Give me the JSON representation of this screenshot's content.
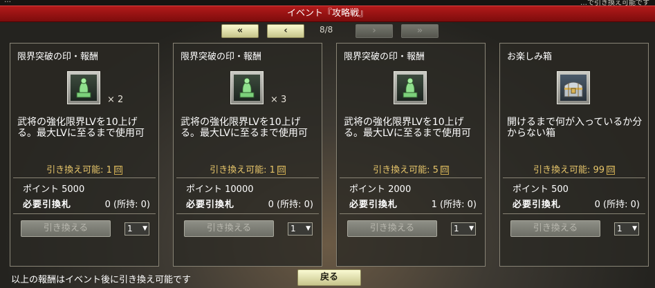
{
  "header": {
    "top_left": "…",
    "top_right": "…で引き換え可能です",
    "title": "イベント『攻略戦』"
  },
  "pager": {
    "first_label": "«",
    "prev_label": "‹",
    "indicator": "8/8",
    "next_label": "›",
    "last_label": "»"
  },
  "cards": [
    {
      "title": "限界突破の印・報酬",
      "icon": "jade-seal-icon",
      "quantity": "× 2",
      "description": "武将の強化限界LVを10上げる。最大LVに至るまで使用可",
      "exchangeable_label": "引き換え可能: 1",
      "exchangeable_unit": "回",
      "points": "ポイント 5000",
      "ticket_label": "必要引換札",
      "ticket_value": "0 (所持: 0)",
      "button": "引き換える",
      "select_value": "1"
    },
    {
      "title": "限界突破の印・報酬",
      "icon": "jade-seal-icon",
      "quantity": "× 3",
      "description": "武将の強化限界LVを10上げる。最大LVに至るまで使用可",
      "exchangeable_label": "引き換え可能: 1",
      "exchangeable_unit": "回",
      "points": "ポイント 10000",
      "ticket_label": "必要引換札",
      "ticket_value": "0 (所持: 0)",
      "button": "引き換える",
      "select_value": "1"
    },
    {
      "title": "限界突破の印・報酬",
      "icon": "jade-seal-icon",
      "quantity": "",
      "description": "武将の強化限界LVを10上げる。最大LVに至るまで使用可",
      "exchangeable_label": "引き換え可能: 5",
      "exchangeable_unit": "回",
      "points": "ポイント 2000",
      "ticket_label": "必要引換札",
      "ticket_value": "1 (所持: 0)",
      "button": "引き換える",
      "select_value": "1"
    },
    {
      "title": "お楽しみ箱",
      "icon": "treasure-chest-icon",
      "quantity": "",
      "description": "開けるまで何が入っているか分からない箱",
      "exchangeable_label": "引き換え可能: 99",
      "exchangeable_unit": "回",
      "points": "ポイント 500",
      "ticket_label": "必要引換札",
      "ticket_value": "0 (所持: 0)",
      "button": "引き換える",
      "select_value": "1"
    }
  ],
  "footer": {
    "note": "以上の報酬はイベント後に引き換え可能です",
    "back_button": "戻る"
  },
  "colors": {
    "title_bar": "#9e1414",
    "accent_gold": "#e6c56a",
    "button_active": "#e8e7b4",
    "button_disabled": "#7d7e75"
  }
}
